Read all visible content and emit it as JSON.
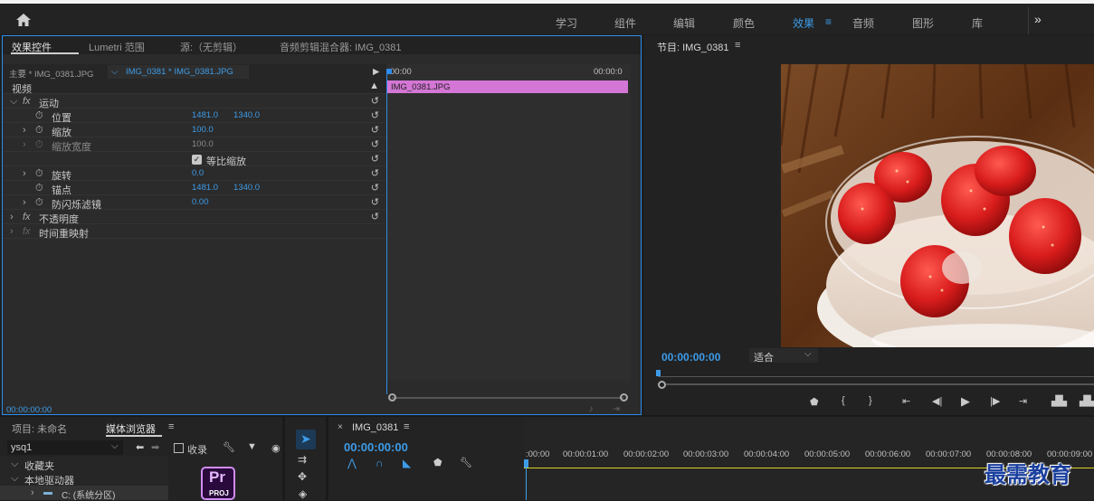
{
  "top_nav": {
    "items": [
      "学习",
      "组件",
      "编辑",
      "颜色",
      "效果",
      "音频",
      "图形",
      "库"
    ],
    "active": "效果",
    "more": "»"
  },
  "effect_controls": {
    "tabs": [
      "效果控件",
      "Lumetri 范围",
      "源:（无剪辑）",
      "音频剪辑混合器: IMG_0381"
    ],
    "master_label": "主要 * IMG_0381.JPG",
    "sequence_label": "IMG_0381 * IMG_0381.JPG",
    "time_start": "00:00",
    "time_end": "00:00:0",
    "clip_name": "IMG_0381.JPG",
    "video_header": "视频",
    "rows": [
      {
        "label": "运动",
        "fx": true
      },
      {
        "label": "位置",
        "v1": "1481.0",
        "v2": "1340.0"
      },
      {
        "label": "缩放",
        "v1": "100.0"
      },
      {
        "label": "缩放宽度",
        "v1": "100.0"
      },
      {
        "label": "等比缩放"
      },
      {
        "label": "旋转",
        "v1": "0.0"
      },
      {
        "label": "锚点",
        "v1": "1481.0",
        "v2": "1340.0"
      },
      {
        "label": "防闪烁滤镜",
        "v1": "0.00"
      },
      {
        "label": "不透明度",
        "fx": true
      },
      {
        "label": "时间重映射",
        "fx": true
      }
    ],
    "timecode": "00:00:00:00"
  },
  "program_monitor": {
    "title": "节目: IMG_0381",
    "timecode": "00:00:00:00",
    "fit": "适合"
  },
  "project_panel": {
    "tabs": [
      "项目: 未命名",
      "媒体浏览器"
    ],
    "dropdown": "ysq1",
    "ingest": "收录",
    "tree": [
      "收藏夹",
      "本地驱动器",
      "C: (系统分区)"
    ],
    "proj_icon": {
      "top": "Pr",
      "bottom": "PROJ"
    }
  },
  "timeline": {
    "sequence": "IMG_0381",
    "timecode": "00:00:00:00",
    "ruler": [
      ":00:00",
      "00:00:01:00",
      "00:00:02:00",
      "00:00:03:00",
      "00:00:04:00",
      "00:00:05:00",
      "00:00:06:00",
      "00:00:07:00",
      "00:00:08:00",
      "00:00:09:00"
    ]
  },
  "watermark": "最需教育"
}
